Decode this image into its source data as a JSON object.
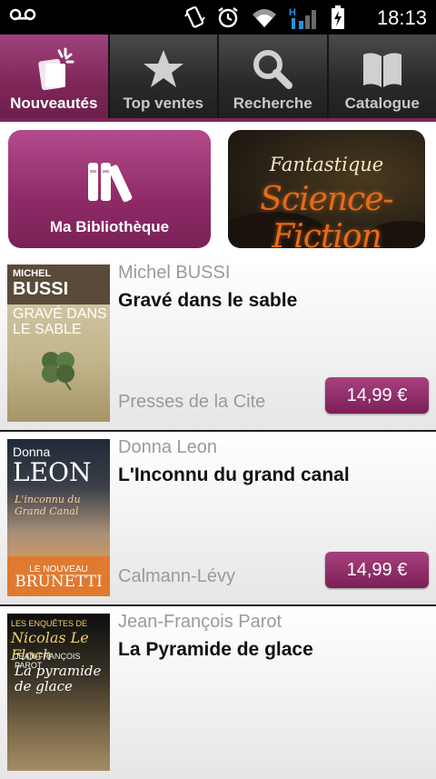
{
  "status_bar": {
    "time": "18:13"
  },
  "tabs": [
    {
      "label": "Nouveautés",
      "icon": "new-items-icon",
      "active": true
    },
    {
      "label": "Top ventes",
      "icon": "star-icon",
      "active": false
    },
    {
      "label": "Recherche",
      "icon": "search-icon",
      "active": false
    },
    {
      "label": "Catalogue",
      "icon": "open-book-icon",
      "active": false
    }
  ],
  "library_banner": {
    "label": "Ma Bibliothèque",
    "icon": "books-icon"
  },
  "genre_banner": {
    "subtitle": "Fantastique",
    "title": "Science-Fiction"
  },
  "books": [
    {
      "author": "Michel BUSSI",
      "title": "Gravé dans le sable",
      "publisher": "Presses de la Cite",
      "price": "14,99 €",
      "cover": {
        "author_small": "MICHEL",
        "author_big": "BUSSI",
        "title": "GRAVÉ DANS LE SABLE"
      }
    },
    {
      "author": "Donna Leon",
      "title": "L'Inconnu du grand canal",
      "publisher": "Calmann-Lévy",
      "price": "14,99 €",
      "cover": {
        "author_small": "Donna",
        "author_big": "LEON",
        "title": "L'inconnu du Grand Canal",
        "band_small": "LE NOUVEAU",
        "band_big": "BRUNETTI"
      }
    },
    {
      "author": "Jean-François Parot",
      "title": "La Pyramide de glace",
      "publisher": "",
      "price": "",
      "cover": {
        "series": "LES ENQUÊTES DE",
        "hero": "Nicolas Le Floch",
        "author": "JEAN-FRANÇOIS PAROT",
        "title": "La pyramide de glace"
      }
    }
  ]
}
